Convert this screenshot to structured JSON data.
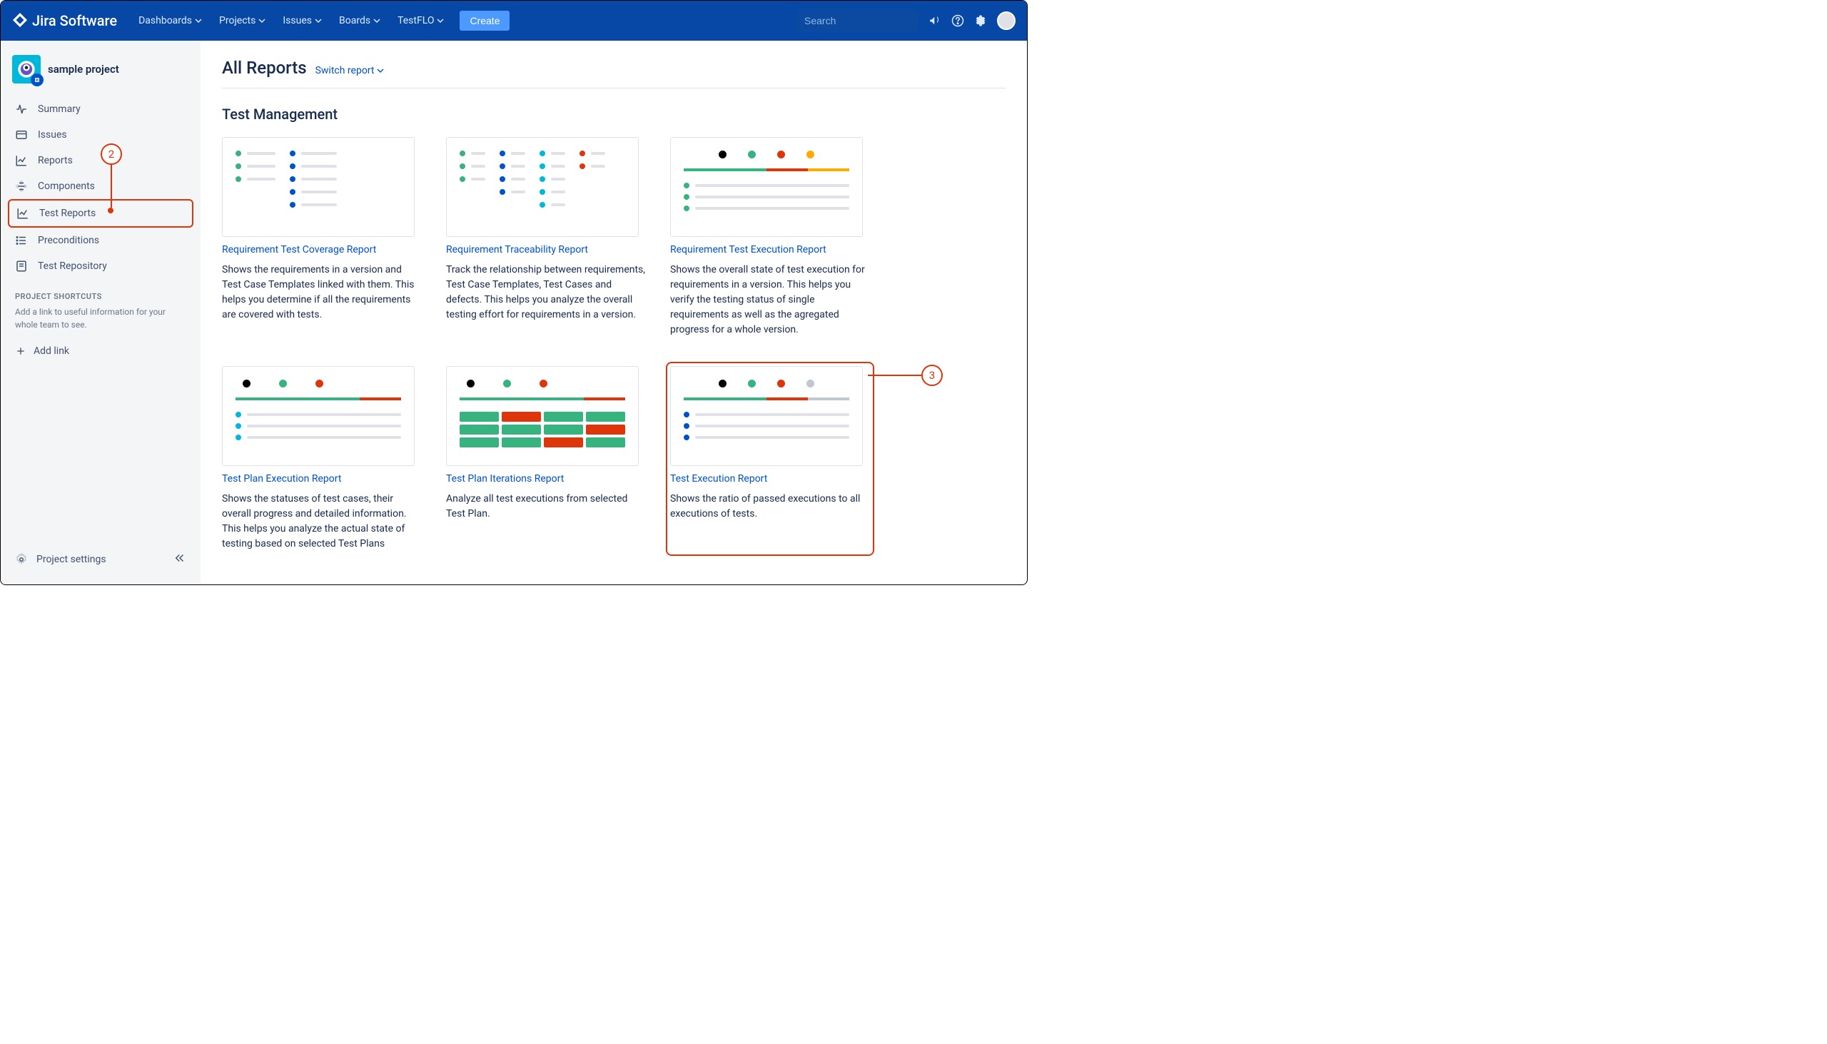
{
  "header": {
    "logo": "Jira Software",
    "nav": [
      "Dashboards",
      "Projects",
      "Issues",
      "Boards",
      "TestFLO"
    ],
    "create": "Create",
    "search_placeholder": "Search"
  },
  "sidebar": {
    "project": "sample project",
    "items": [
      {
        "label": "Summary"
      },
      {
        "label": "Issues"
      },
      {
        "label": "Reports"
      },
      {
        "label": "Components"
      },
      {
        "label": "Test Reports"
      },
      {
        "label": "Preconditions"
      },
      {
        "label": "Test Repository"
      }
    ],
    "shortcuts_heading": "PROJECT SHORTCUTS",
    "shortcuts_desc": "Add a link to useful information for your whole team to see.",
    "add_link": "Add link",
    "settings": "Project settings"
  },
  "main": {
    "title": "All Reports",
    "switch": "Switch report",
    "section": "Test Management",
    "cards": [
      {
        "title": "Requirement Test Coverage Report",
        "desc": "Shows the requirements in a version and Test Case Templates linked with them. This helps you determine if all the requirements are covered with tests."
      },
      {
        "title": "Requirement Traceability Report",
        "desc": "Track the relationship between requirements, Test Case Templates, Test Cases and defects. This helps you analyze the overall testing effort for requirements in a version."
      },
      {
        "title": "Requirement Test Execution Report",
        "desc": "Shows the overall state of test execution for requirements in a version. This helps you verify the testing status of single requirements as well as the agregated progress for a whole version."
      },
      {
        "title": "Test Plan Execution Report",
        "desc": "Shows the statuses of test cases, their overall progress and detailed information. This helps you analyze the actual state of testing based on selected Test Plans"
      },
      {
        "title": "Test Plan Iterations Report",
        "desc": "Analyze all test executions from selected Test Plan."
      },
      {
        "title": "Test Execution Report",
        "desc": "Shows the ratio of passed executions to all executions of tests."
      }
    ]
  },
  "callouts": {
    "c2": "2",
    "c3": "3"
  }
}
